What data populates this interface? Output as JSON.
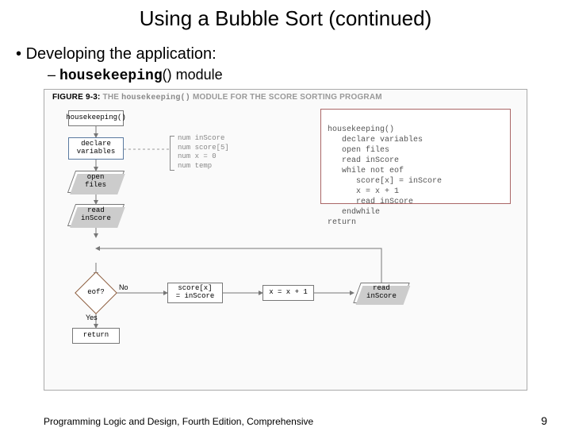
{
  "title": "Using a Bubble Sort (continued)",
  "bullets": {
    "b1": "Developing the application:",
    "b2_mono": "housekeeping",
    "b2_tail": "() module"
  },
  "figure": {
    "caption_prefix": "FIGURE 9-3:",
    "caption_mid": "THE",
    "caption_mono": "housekeeping()",
    "caption_tail": "MODULE FOR THE SCORE SORTING PROGRAM"
  },
  "flow": {
    "start": "housekeeping()",
    "declare": "declare\nvariables",
    "open": "open\nfiles",
    "read1": "read\ninScore",
    "eof": "eof?",
    "no": "No",
    "yes": "Yes",
    "assign": "score[x]\n= inScore",
    "incr": "x = x + 1",
    "read2": "read\ninScore",
    "ret": "return"
  },
  "vars": {
    "l1": "num inScore",
    "l2": "num score[5]",
    "l3": "num x = 0",
    "l4": "num temp"
  },
  "pseudo": {
    "p1": "housekeeping()",
    "p2": "   declare variables",
    "p3": "   open files",
    "p4": "   read inScore",
    "p5": "   while not eof",
    "p6": "      score[x] = inScore",
    "p7": "      x = x + 1",
    "p8": "      read inScore",
    "p9": "   endwhile",
    "p10": "return"
  },
  "footer": {
    "left": "Programming Logic and Design, Fourth Edition, Comprehensive",
    "right": "9"
  }
}
